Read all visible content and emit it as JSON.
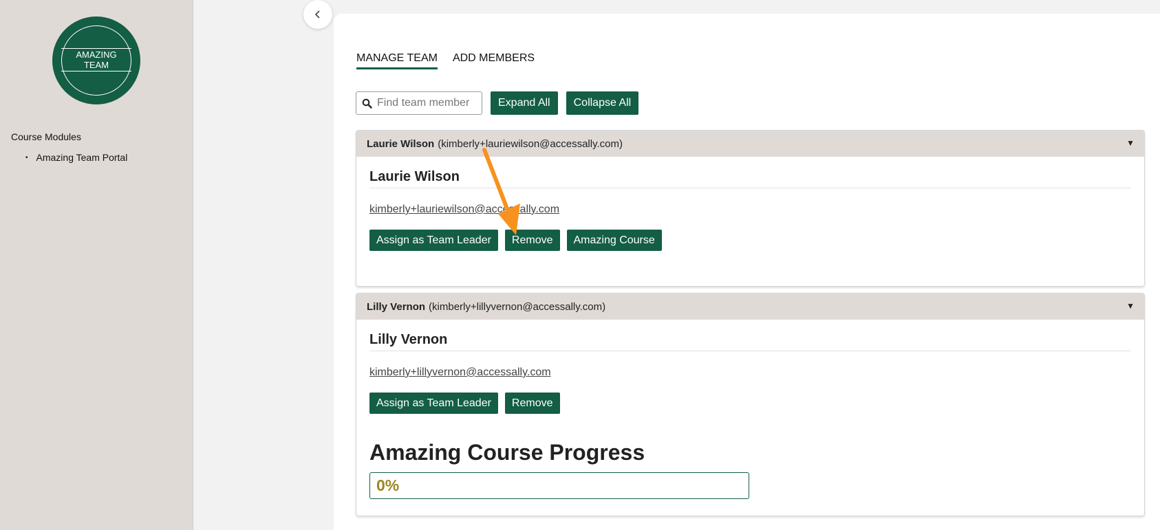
{
  "sidebar": {
    "logo_text": "AMAZING TEAM",
    "modules_title": "Course Modules",
    "modules": [
      {
        "label": "Amazing Team Portal"
      }
    ]
  },
  "tabs": [
    {
      "label": "MANAGE TEAM",
      "active": true
    },
    {
      "label": "ADD MEMBERS",
      "active": false
    }
  ],
  "toolbar": {
    "search_placeholder": "Find team member",
    "expand_label": "Expand All",
    "collapse_label": "Collapse All"
  },
  "members": [
    {
      "name": "Laurie Wilson",
      "email_paren": "(kimberly+lauriewilson@accessally.com)",
      "email": "kimberly+lauriewilson@accessally.com",
      "buttons": [
        "Assign as Team Leader",
        "Remove",
        "Amazing Course"
      ]
    },
    {
      "name": "Lilly Vernon",
      "email_paren": "(kimberly+lillyvernon@accessally.com)",
      "email": "kimberly+lillyvernon@accessally.com",
      "buttons": [
        "Assign as Team Leader",
        "Remove"
      ],
      "progress_title": "Amazing Course Progress",
      "progress_text": "0%",
      "progress_fraction": 0
    }
  ],
  "colors": {
    "brand_green": "#135e45",
    "sidebar_bg": "#e0dad6",
    "progress_text": "#9a8726",
    "annotation_arrow": "#f7921e"
  },
  "icons": {
    "search": "search-icon",
    "collapse": "chevron-left-icon",
    "card_caret": "caret-down-icon"
  }
}
